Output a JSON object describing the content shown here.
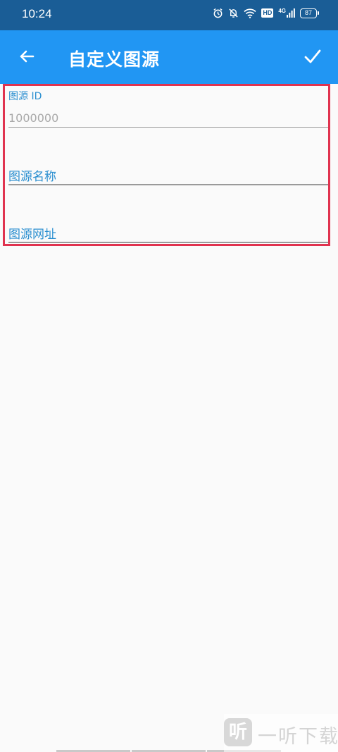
{
  "status_bar": {
    "time": "10:24",
    "network": "4G",
    "hd_badge": "HD",
    "battery": "87",
    "icons": [
      "alarm-icon",
      "mute-bell-icon",
      "wifi-icon",
      "hd-icon",
      "signal-icon",
      "battery-icon"
    ]
  },
  "app_bar": {
    "title": "自定义图源",
    "back_icon": "arrow-left-icon",
    "confirm_icon": "check-icon",
    "background": "#2196f3"
  },
  "form": {
    "fields": [
      {
        "label": "图源 ID",
        "value": "",
        "placeholder": "1000000"
      },
      {
        "label": "图源名称",
        "value": "",
        "placeholder": ""
      },
      {
        "label": "图源网址",
        "value": "",
        "placeholder": ""
      }
    ]
  },
  "watermark": {
    "logo": "听",
    "text": "一听下载"
  },
  "colors": {
    "status_bar": "#1a5d96",
    "accent": "#2b8fd0",
    "highlight": "#e0334f"
  }
}
